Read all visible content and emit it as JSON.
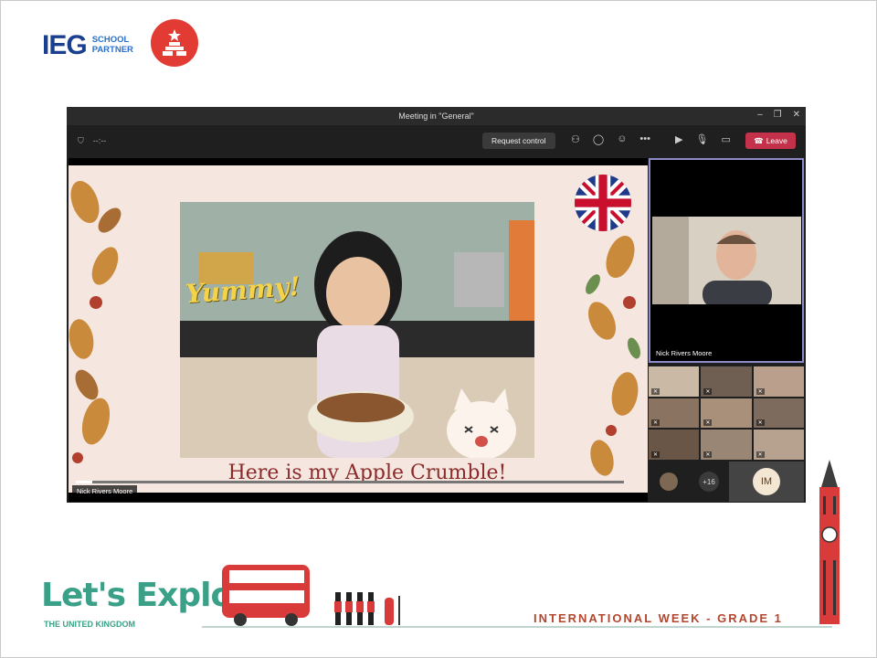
{
  "header": {
    "ieg_logo_text": "IEG",
    "ieg_sub_line1": "SCHOOL",
    "ieg_sub_line2": "PARTNER"
  },
  "meeting": {
    "window_title": "Meeting in \"General\"",
    "timer": "--:--",
    "request_control_label": "Request control",
    "leave_label": "Leave",
    "shared_content": {
      "yummy_text": "Yummy!",
      "caption": "Here is my Apple Crumble!",
      "presenter_tag": "Nick Rivers Moore",
      "playback_progress": 0.03
    },
    "speaker": {
      "name": "Nick Rivers Moore"
    },
    "overflow_count": "+16",
    "initials": "IM"
  },
  "footer": {
    "lets_explore": "Let's Explore",
    "subtitle": "THE UNITED KINGDOM",
    "event": "INTERNATIONAL WEEK - GRADE 1"
  },
  "colors": {
    "leave": "#c4314b",
    "speaker_border": "#8b8cc7",
    "brand_green": "#3aa188",
    "brand_red": "#b3462e"
  }
}
